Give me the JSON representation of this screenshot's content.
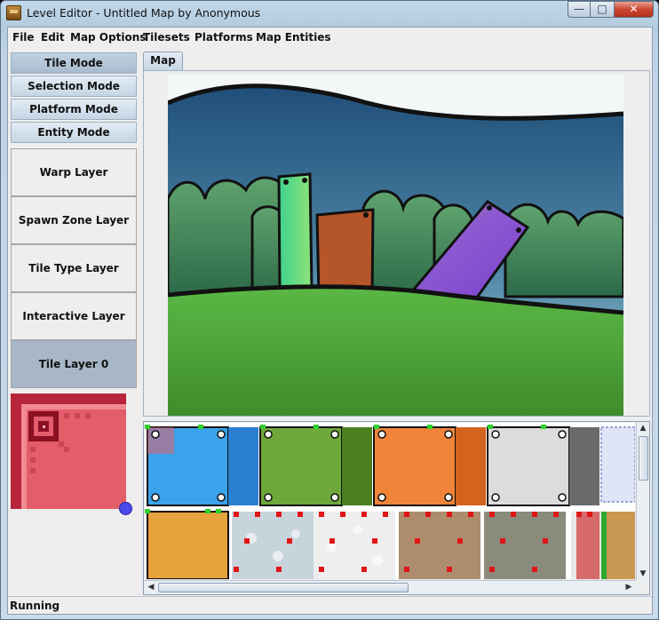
{
  "window": {
    "title": "Level Editor - Untitled Map by Anonymous",
    "controls": {
      "minimize": "—",
      "maximize": "□",
      "close": "✕"
    }
  },
  "menu": [
    "File",
    "Edit",
    "Map Options",
    "Tilesets",
    "Platforms",
    "Map Entities"
  ],
  "modes": {
    "tile": "Tile Mode",
    "selection": "Selection Mode",
    "platform": "Platform Mode",
    "entity": "Entity Mode",
    "active": "Tile Mode"
  },
  "layers": {
    "warp": "Warp Layer",
    "spawn": "Spawn Zone Layer",
    "tile_type": "Tile Type Layer",
    "interactive": "Interactive Layer",
    "tile0": "Tile Layer 0",
    "active": "Tile Layer 0"
  },
  "tabs": {
    "map": "Map"
  },
  "status": {
    "text": "Running"
  },
  "colors": {
    "sky_top": "#1f4e79",
    "sky_bottom": "#9cc6d6",
    "grass": "#4fa638",
    "tile_blue": "#3aa3ec",
    "tile_green": "#6fa83a",
    "tile_orange": "#f2843a",
    "tile_white": "#dcdcdc",
    "tile_yellow": "#e6a23c",
    "selected_layer": "#a7b7c8",
    "preview_red": "#e35d6a"
  },
  "icons": {
    "app": "toolbox-icon",
    "scroll_left": "arrow-left-icon",
    "scroll_right": "arrow-right-icon",
    "scroll_up": "arrow-up-icon",
    "scroll_down": "arrow-down-icon"
  }
}
